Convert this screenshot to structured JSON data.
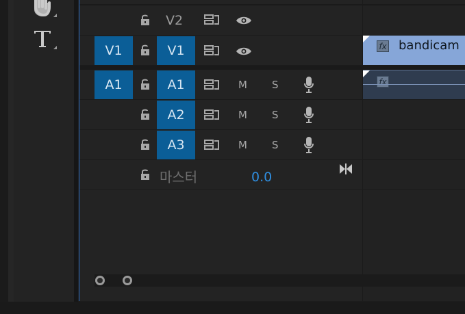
{
  "tools": {
    "hand_icon": "hand-icon",
    "type_icon": "type-tool-icon"
  },
  "tracks": {
    "video": [
      {
        "source_patch": "",
        "target": "V2"
      },
      {
        "source_patch": "V1",
        "target": "V1"
      }
    ],
    "audio": [
      {
        "source_patch": "A1",
        "target": "A1",
        "mute": "M",
        "solo": "S"
      },
      {
        "source_patch": "",
        "target": "A2",
        "mute": "M",
        "solo": "S"
      },
      {
        "source_patch": "",
        "target": "A3",
        "mute": "M",
        "solo": "S"
      }
    ],
    "master": {
      "label": "마스터",
      "value": "0.0"
    }
  },
  "clips": {
    "video_clip_name": "bandicam",
    "fx_label": "fx"
  },
  "colors": {
    "patch_blue": "#0b5e97",
    "accent_blue": "#2f8ee0",
    "clip_video": "#86a6d8",
    "clip_audio": "#2f3c4f"
  }
}
